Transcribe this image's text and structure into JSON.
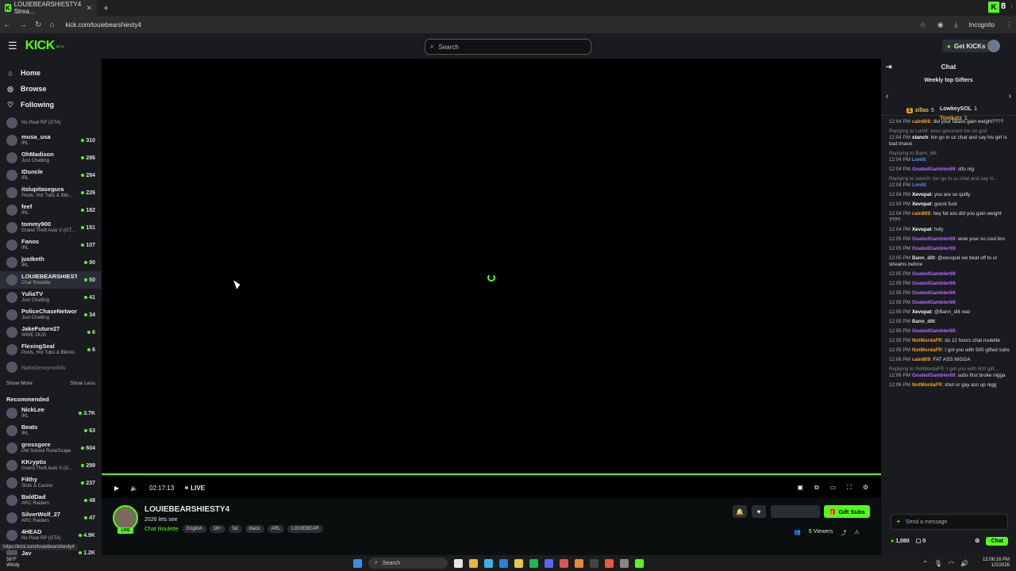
{
  "browser": {
    "tab_title": "LOUIEBEARSHIESTY4 Strea...",
    "url": "kick.com/louiebearshiesty4",
    "incognito": "Incognito",
    "overlay_count": "8"
  },
  "header": {
    "logo": "KICK",
    "logo_sup": "BETA",
    "search_placeholder": "Search",
    "get_kicks": "Get KICKs"
  },
  "nav": [
    {
      "label": "Home",
      "icon": "home-icon"
    },
    {
      "label": "Browse",
      "icon": "compass-icon"
    },
    {
      "label": "Following",
      "icon": "heart-icon"
    }
  ],
  "following": [
    {
      "name": "",
      "category": "No Pixel RP (GTA)",
      "viewers": ""
    },
    {
      "name": "musa_usa",
      "category": "IRL",
      "viewers": "310"
    },
    {
      "name": "OhMadison",
      "category": "Just Chatting",
      "viewers": "286"
    },
    {
      "name": "IDuncle",
      "category": "IRL",
      "viewers": "284"
    },
    {
      "name": "itslupitasegura",
      "category": "Pools, Hot Tubs & Biki...",
      "viewers": "226"
    },
    {
      "name": "feef",
      "category": "IRL",
      "viewers": "182"
    },
    {
      "name": "tommy900",
      "category": "Grand Theft Auto V (GT...",
      "viewers": "151"
    },
    {
      "name": "Fanos",
      "category": "IRL",
      "viewers": "107"
    },
    {
      "name": "justketh",
      "category": "IRL",
      "viewers": "90"
    },
    {
      "name": "LOUIEBEARSHIESTY4",
      "category": "Chat Roulette",
      "viewers": "50"
    },
    {
      "name": "YuliaTV",
      "category": "Just Chatting",
      "viewers": "41"
    },
    {
      "name": "PoliceChaseNetwork",
      "category": "Just Chatting",
      "viewers": "34"
    },
    {
      "name": "JakeFuture27",
      "category": "WWE 2K25",
      "viewers": "6"
    },
    {
      "name": "FlexingSeal",
      "category": "Pools, Hot Tubs & Bikinis",
      "viewers": "6"
    },
    {
      "name": "Natalieraynolds",
      "category": "",
      "viewers": ""
    }
  ],
  "show_more": "Show More",
  "show_less": "Show Less",
  "recommended_title": "Recommended",
  "recommended": [
    {
      "name": "NickLee",
      "category": "IRL",
      "viewers": "3.7K"
    },
    {
      "name": "Beats",
      "category": "IRL",
      "viewers": "63"
    },
    {
      "name": "grossgore",
      "category": "Old School RuneScape",
      "viewers": "604"
    },
    {
      "name": "KKryptix",
      "category": "Grand Theft Auto V (G...",
      "viewers": "299"
    },
    {
      "name": "Filthy",
      "category": "Slots & Casino",
      "viewers": "237"
    },
    {
      "name": "BaldDad",
      "category": "ARC Raiders",
      "viewers": "48"
    },
    {
      "name": "SilverWolf_27",
      "category": "ARC Raiders",
      "viewers": "47"
    },
    {
      "name": "4HEAD",
      "category": "No Pixel RP (GTA)",
      "viewers": "4.9K"
    },
    {
      "name": "Jay",
      "category": "",
      "viewers": "1.2K"
    }
  ],
  "player": {
    "time": "02:17:13",
    "live": "LIVE",
    "progress": 1.0
  },
  "stream": {
    "streamer": "LOUIEBEARSHIESTY4",
    "title": "2026 lets see",
    "category": "Chat Roulette",
    "live_badge": "LIVE",
    "tags": [
      "English",
      "18+",
      "fat",
      "black",
      "ARL",
      "LOUIEBEAR"
    ],
    "gift_subs": "Gift Subs",
    "viewers_count": "5",
    "viewers_label": "Viewers"
  },
  "chat": {
    "title": "Chat",
    "gifters_title": "Weekly top Gifters",
    "gifters": [
      {
        "name": "zillas",
        "count": "5"
      },
      {
        "name": "LowkeySOL",
        "count": "1"
      },
      {
        "name": "Tomkatz",
        "count": "1"
      }
    ],
    "messages": [
      {
        "reply": "",
        "time": "12:04 PM",
        "user": "cain809",
        "color": "#ff9f1c",
        "text": "did your fatass gain weight????"
      },
      {
        "reply": "Replying to LonIit: xevo groomed me on god",
        "time": "12:04 PM",
        "user": "stanch",
        "color": "#ffffff",
        "text": "lon go in uc chat and say his girl is bad lmaoo"
      },
      {
        "reply": "Replying to Bann_dilt:",
        "time": "12:04 PM",
        "user": "LonIit",
        "color": "#5b8def",
        "text": ""
      },
      {
        "reply": "",
        "time": "12:04 PM",
        "user": "GoatedGambler69",
        "color": "#b86bff",
        "text": "stfu nig"
      },
      {
        "reply": "Replying to stanch: lon go in uc chat and say hi...",
        "time": "12:04 PM",
        "user": "LonIit",
        "color": "#5b8def",
        "text": ""
      },
      {
        "reply": "",
        "time": "12:04 PM",
        "user": "Xevopat",
        "color": "#ffffff",
        "text": "you are so quilly"
      },
      {
        "reply": "",
        "time": "12:04 PM",
        "user": "Xevopat",
        "color": "#ffffff",
        "text": "gooot fuck"
      },
      {
        "reply": "",
        "time": "12:04 PM",
        "user": "cain809",
        "color": "#ff9f1c",
        "text": "hey fat ass did you gain weight ????"
      },
      {
        "reply": "",
        "time": "12:04 PM",
        "user": "Xevopat",
        "color": "#ffffff",
        "text": "holy"
      },
      {
        "reply": "",
        "time": "12:05 PM",
        "user": "GoatedGambler69",
        "color": "#b86bff",
        "text": "wow your so cool bro"
      },
      {
        "reply": "",
        "time": "12:05 PM",
        "user": "GoatedGambler69",
        "color": "#b86bff",
        "text": ""
      },
      {
        "reply": "",
        "time": "12:05 PM",
        "user": "Bann_dilt",
        "color": "#dddddd",
        "text": "@xevopat ive beat off to ur streams before"
      },
      {
        "reply": "",
        "time": "12:05 PM",
        "user": "GoatedGambler69",
        "color": "#b86bff",
        "text": ""
      },
      {
        "reply": "",
        "time": "12:05 PM",
        "user": "GoatedGambler69",
        "color": "#b86bff",
        "text": ""
      },
      {
        "reply": "",
        "time": "12:05 PM",
        "user": "GoatedGambler69",
        "color": "#b86bff",
        "text": ""
      },
      {
        "reply": "",
        "time": "12:05 PM",
        "user": "GoatedGambler69",
        "color": "#b86bff",
        "text": ""
      },
      {
        "reply": "",
        "time": "12:05 PM",
        "user": "Xevopat",
        "color": "#ffffff",
        "text": "@Bann_dilt real"
      },
      {
        "reply": "",
        "time": "12:05 PM",
        "user": "Bann_dilt",
        "color": "#dddddd",
        "text": ""
      },
      {
        "reply": "",
        "time": "12:05 PM",
        "user": "GoatedGambler69",
        "color": "#b86bff",
        "text": ""
      },
      {
        "reply": "",
        "time": "12:05 PM",
        "user": "NotMordaFR",
        "color": "#ff9f1c",
        "text": "do 12 hours chat roulette"
      },
      {
        "reply": "",
        "time": "12:05 PM",
        "user": "NotMordaFR",
        "color": "#ff9f1c",
        "text": "I got you with 500 gifted subs"
      },
      {
        "reply": "",
        "time": "12:06 PM",
        "user": "cain809",
        "color": "#ff9f1c",
        "text": "FAT ASS NIGGA"
      },
      {
        "reply": "Replying to NotMordaFR: I got you with 500 gift...",
        "time": "12:06 PM",
        "user": "GoatedGambler69",
        "color": "#b86bff",
        "text": "subs first broke nigga"
      },
      {
        "reply": "",
        "time": "12:06 PM",
        "user": "NotMordaFR",
        "color": "#ff9f1c",
        "text": "shut ur gay ass up nigg"
      }
    ],
    "input_placeholder": "Send a message",
    "kicks_balance": "1,080",
    "other_balance": "0",
    "chat_button": "Chat"
  },
  "status_url": "https://kick.com/louiebearshiesty4",
  "taskbar": {
    "temp": "58°F",
    "weather": "Windy",
    "search": "Search",
    "time": "12:06:16 PM",
    "date": "1/2/2026"
  }
}
